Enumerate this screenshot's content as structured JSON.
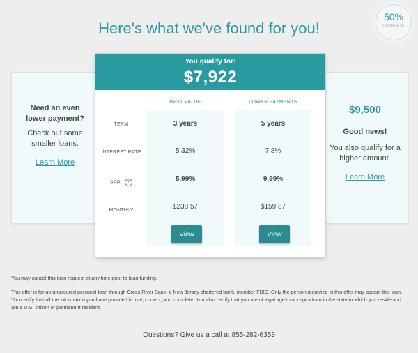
{
  "progress": {
    "percent": "50%",
    "label": "COMPLETE"
  },
  "headline": "Here's what we've found for you!",
  "left_card": {
    "title": "Need an even lower payment?",
    "body": "Check out some smaller loans.",
    "link": "Learn More"
  },
  "right_card": {
    "amount": "$9,500",
    "title": "Good news!",
    "body": "You also qualify for a higher amount.",
    "link": "Learn More"
  },
  "main": {
    "qualify_label": "You qualify for:",
    "amount": "$7,922",
    "row_labels": {
      "term": "TERM",
      "interest": "INTEREST RATE",
      "apr": "APR",
      "monthly": "MONTHLY"
    },
    "apr_help": "?",
    "offers": [
      {
        "heading": "BEST VALUE",
        "term": "3 years",
        "interest": "5.32%",
        "apr": "5.99%",
        "monthly": "$238.57",
        "button": "View"
      },
      {
        "heading": "LOWER PAYMENTS",
        "term": "5 years",
        "interest": "7.8%",
        "apr": "9.99%",
        "monthly": "$159.87",
        "button": "View"
      }
    ]
  },
  "disclaimer": {
    "line1": "You may cancel this loan request at any time prior to loan funding.",
    "line2": "This offer is for an unsecured personal loan through Cross River Bank, a New Jersey chartered bank, member FDIC. Only the person identified in this offer may accept this loan. You certify that all the information you have provided is true, correct, and complete. You also certify that you are of legal age to accept a loan in the state in which you reside and are a U.S. citizen or permanent resident."
  },
  "contact": "Questions? Give us a call at 855-282-6353",
  "colors": {
    "accent": "#2a9aa1",
    "button": "#2a8b91",
    "panel": "#f0fafb"
  }
}
